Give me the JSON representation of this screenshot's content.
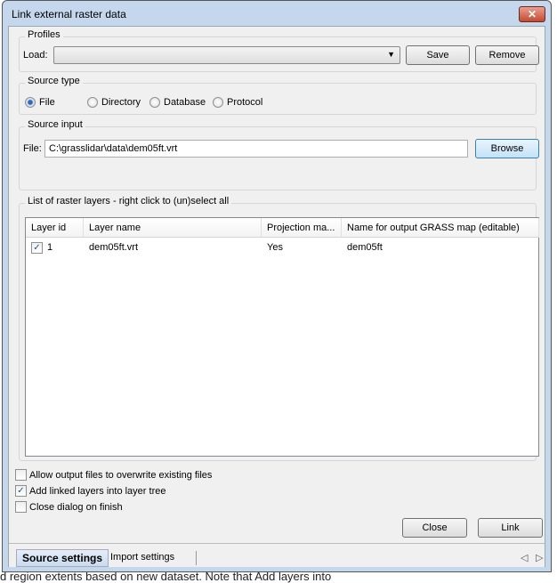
{
  "window": {
    "title": "Link external raster data",
    "close_icon": "close-icon"
  },
  "profiles": {
    "label": "Profiles",
    "load_label": "Load:",
    "load_value": "",
    "save": "Save",
    "remove": "Remove"
  },
  "source_type": {
    "label": "Source type",
    "options": [
      {
        "label": "File",
        "selected": true
      },
      {
        "label": "Directory",
        "selected": false
      },
      {
        "label": "Database",
        "selected": false
      },
      {
        "label": "Protocol",
        "selected": false
      }
    ]
  },
  "source_input": {
    "label": "Source input",
    "file_label": "File:",
    "file_value": "C:\\grasslidar\\data\\dem05ft.vrt",
    "browse": "Browse"
  },
  "layers": {
    "label": "List of raster layers - right click to (un)select all",
    "columns": [
      "Layer id",
      "Layer name",
      "Projection ma...",
      "Name for output GRASS map (editable)"
    ],
    "rows": [
      {
        "checked": true,
        "id": "1",
        "name": "dem05ft.vrt",
        "projection": "Yes",
        "output": "dem05ft"
      }
    ]
  },
  "options": [
    {
      "label": "Allow output files to overwrite existing files",
      "checked": false
    },
    {
      "label": "Add linked layers into layer tree",
      "checked": true
    },
    {
      "label": "Close dialog on finish",
      "checked": false
    }
  ],
  "buttons": {
    "close": "Close",
    "link": "Link"
  },
  "tabs": [
    {
      "label": "Source settings",
      "active": true
    },
    {
      "label": "Import settings",
      "active": false
    }
  ],
  "background_text": "d region extents based on new dataset. Note that Add layers into"
}
